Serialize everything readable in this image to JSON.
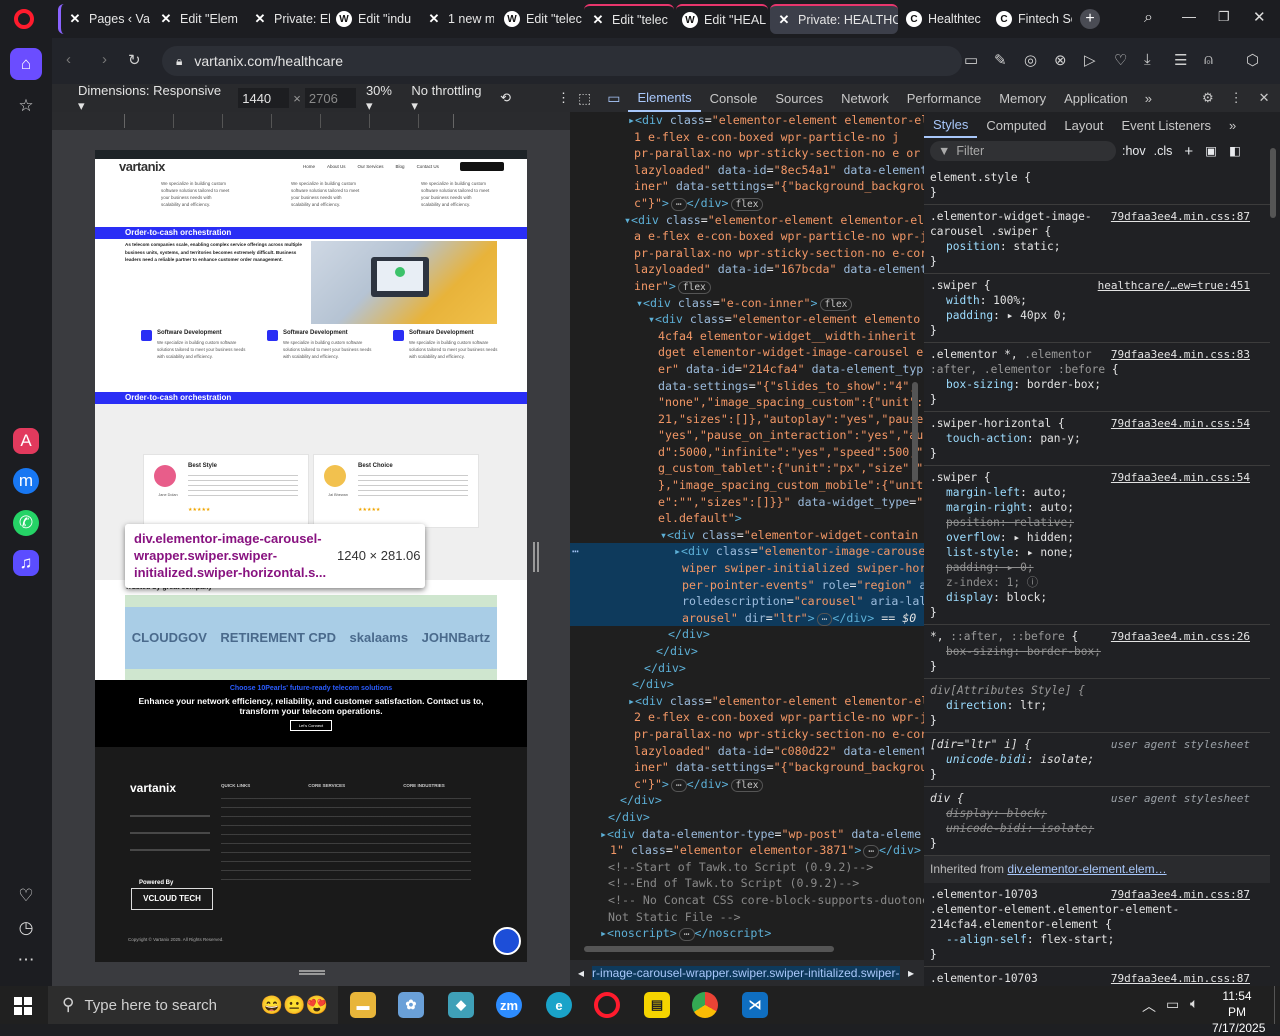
{
  "browser": {
    "tabs": [
      {
        "icon": "wp-x-icon",
        "label": "Pages ‹ Va"
      },
      {
        "icon": "wp-x-icon",
        "label": "Edit \"Elem"
      },
      {
        "icon": "wp-x-icon",
        "label": "Private: Ele"
      },
      {
        "icon": "wp-icon",
        "label": "Edit \"indu"
      },
      {
        "icon": "wp-x-icon",
        "label": "1 new mes"
      },
      {
        "icon": "wp-icon",
        "label": "Edit \"telec"
      },
      {
        "icon": "wp-x-icon",
        "label": "Edit \"telec"
      },
      {
        "icon": "wp-icon",
        "label": "Edit \"HEAL"
      },
      {
        "icon": "wp-x-icon",
        "label": "Private: HEALTHC/"
      },
      {
        "icon": "c-icon",
        "label": "Healthtec"
      },
      {
        "icon": "c-icon",
        "label": "Fintech So"
      }
    ],
    "url": "vartanix.com/healthcare",
    "accent": "#8a63ff"
  },
  "device_toolbar": {
    "dimensions_label": "Dimensions: Responsive",
    "width": "1440",
    "height": "2706",
    "zoom": "30%",
    "throttling": "No throttling"
  },
  "site": {
    "logo": "vartanix",
    "nav": [
      "Home",
      "About Us",
      "Our Services",
      "Blog",
      "Contact Us"
    ],
    "section1": "Order-to-cash orchestration",
    "section1_text": "As telecom companies scale, enabling complex service offerings across multiple business units, systems, and territories becomes extremely difficult. Business leaders need a reliable partner to enhance customer order management.",
    "card_title": "Software Development",
    "card_text": "We specialize in building custom software solutions tailored to meet your business needs with scalability and efficiency.",
    "section2": "Order-to-cash orchestration",
    "testimonials": [
      {
        "title": "Best Style",
        "name": "Jane Dolan"
      },
      {
        "title": "Best Choice",
        "name": "Jai Bhewan"
      }
    ],
    "trusted": "Trusted by great company",
    "logos": [
      "CLOUDGOV",
      "RETIREMENT CPD",
      "skalaams",
      "JOHNBartz"
    ],
    "cta_title": "Choose 10Pearls' future-ready telecom solutions",
    "cta_text": "Enhance your network efficiency, reliability, and customer satisfaction. Contact us to, transform your telecom operations.",
    "cta_button": "Let's Connect",
    "footer_heads": [
      "QUICK LINKS",
      "CORE SERVICES",
      "CORE INDUSTRIES"
    ],
    "powered": "Powered By",
    "vcloud": "VCLOUD TECH",
    "copyright": "Copyright © Vartanix 2025. All Rights Reserved."
  },
  "tooltip": {
    "selector": "div.elementor-image-carousel-wrapper.swiper.swiper-initialized.swiper-horizontal.s...",
    "size": "1240 × 281.06"
  },
  "devtools": {
    "tabs": [
      "Elements",
      "Console",
      "Sources",
      "Network",
      "Performance",
      "Memory",
      "Application"
    ],
    "breadcrumb": "r-image-carousel-wrapper.swiper.swiper-initialized.swiper-",
    "styles_tabs": [
      "Styles",
      "Computed",
      "Layout",
      "Event Listeners"
    ],
    "filter_placeholder": "Filter",
    "hov": ":hov",
    "cls": ".cls",
    "inherited": "Inherited from",
    "inherited_link": "div.elementor-element.elem…"
  },
  "taskbar": {
    "search_placeholder": "Type here to search",
    "time": "11:54 PM",
    "date": "7/17/2025"
  }
}
